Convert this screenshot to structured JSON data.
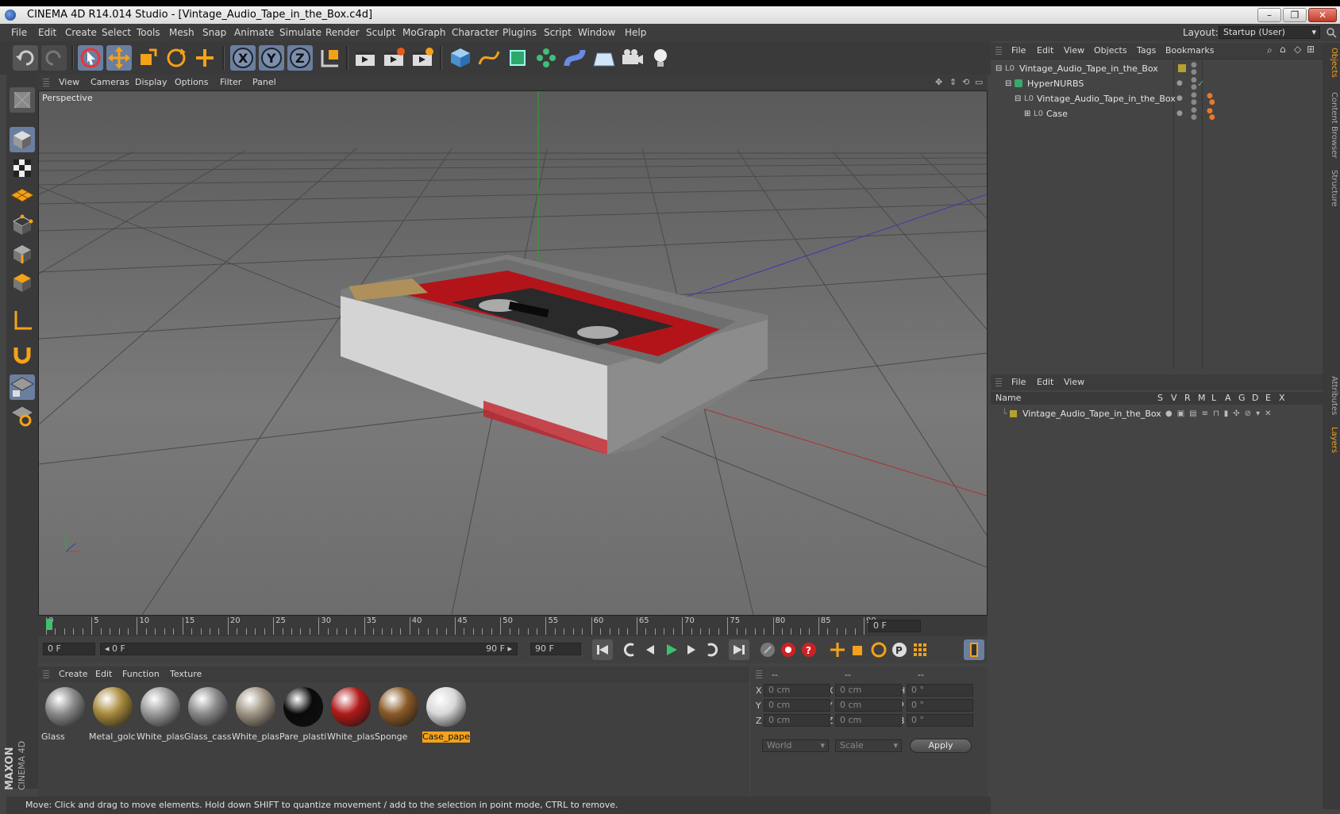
{
  "window": {
    "title": "CINEMA 4D R14.014 Studio - [Vintage_Audio_Tape_in_the_Box.c4d]",
    "minimize": "–",
    "restore": "❐",
    "close": "✕"
  },
  "menubar": {
    "items": [
      "File",
      "Edit",
      "Create",
      "Select",
      "Tools",
      "Mesh",
      "Snap",
      "Animate",
      "Simulate",
      "Render",
      "Sculpt",
      "MoGraph",
      "Character",
      "Plugins",
      "Script",
      "Window",
      "Help"
    ],
    "layout_label": "Layout:",
    "layout_value": "Startup (User)"
  },
  "viewport": {
    "menu": [
      "View",
      "Cameras",
      "Display",
      "Options",
      "Filter",
      "Panel"
    ],
    "label": "Perspective"
  },
  "timeline": {
    "ticks": [
      "0",
      "5",
      "10",
      "15",
      "20",
      "25",
      "30",
      "35",
      "40",
      "45",
      "50",
      "55",
      "60",
      "65",
      "70",
      "75",
      "80",
      "85",
      "90"
    ],
    "current_frame_field": "0 F"
  },
  "transport": {
    "start_field": "0 F",
    "range_start": "◂ 0 F",
    "range_end": "90 F ▸",
    "end_field": "90 F"
  },
  "material_manager": {
    "menu": [
      "Create",
      "Edit",
      "Function",
      "Texture"
    ],
    "materials": [
      {
        "name": "Glass",
        "color": "#8a8a8a"
      },
      {
        "name": "Metal_golc",
        "color": "#a88a3c"
      },
      {
        "name": "White_plas",
        "color": "#9a9a9a"
      },
      {
        "name": "Glass_casse",
        "color": "#8a8a8a"
      },
      {
        "name": "White_plas",
        "color": "#a09484"
      },
      {
        "name": "Pare_plasti",
        "color": "#0a0a0a"
      },
      {
        "name": "White_plas",
        "color": "#b01a1a"
      },
      {
        "name": "Sponge",
        "color": "#8a5a28"
      },
      {
        "name": "Case_pape",
        "color": "#d8d8d8"
      }
    ]
  },
  "coordinates": {
    "headers": [
      "--",
      "--",
      "--"
    ],
    "rows": [
      {
        "l1": "X",
        "v1": "0 cm",
        "l2": "X",
        "v2": "0 cm",
        "l3": "H",
        "v3": "0 °"
      },
      {
        "l1": "Y",
        "v1": "0 cm",
        "l2": "Y",
        "v2": "0 cm",
        "l3": "P",
        "v3": "0 °"
      },
      {
        "l1": "Z",
        "v1": "0 cm",
        "l2": "Z",
        "v2": "0 cm",
        "l3": "B",
        "v3": "0 °"
      }
    ],
    "mode1": "World",
    "mode2": "Scale",
    "apply": "Apply"
  },
  "status": "Move: Click and drag to move elements. Hold down SHIFT to quantize movement / add to the selection in point mode, CTRL to remove.",
  "object_manager": {
    "menu": [
      "File",
      "Edit",
      "View",
      "Objects",
      "Tags",
      "Bookmarks"
    ],
    "objects": [
      {
        "name": "Vintage_Audio_Tape_in_the_Box"
      },
      {
        "name": "HyperNURBS"
      },
      {
        "name": "Vintage_Audio_Tape_in_the_Box"
      },
      {
        "name": "Case"
      }
    ]
  },
  "layer_manager": {
    "menu": [
      "File",
      "Edit",
      "View"
    ],
    "columns": [
      "Name",
      "S",
      "V",
      "R",
      "M",
      "L",
      "A",
      "G",
      "D",
      "E",
      "X"
    ],
    "layers": [
      {
        "name": "Vintage_Audio_Tape_in_the_Box"
      }
    ]
  },
  "side_tabs": [
    "Objects",
    "Content Browser",
    "Structure",
    "Attributes",
    "Layers"
  ],
  "branding": {
    "line1": "MAXON",
    "line2": "CINEMA 4D"
  }
}
